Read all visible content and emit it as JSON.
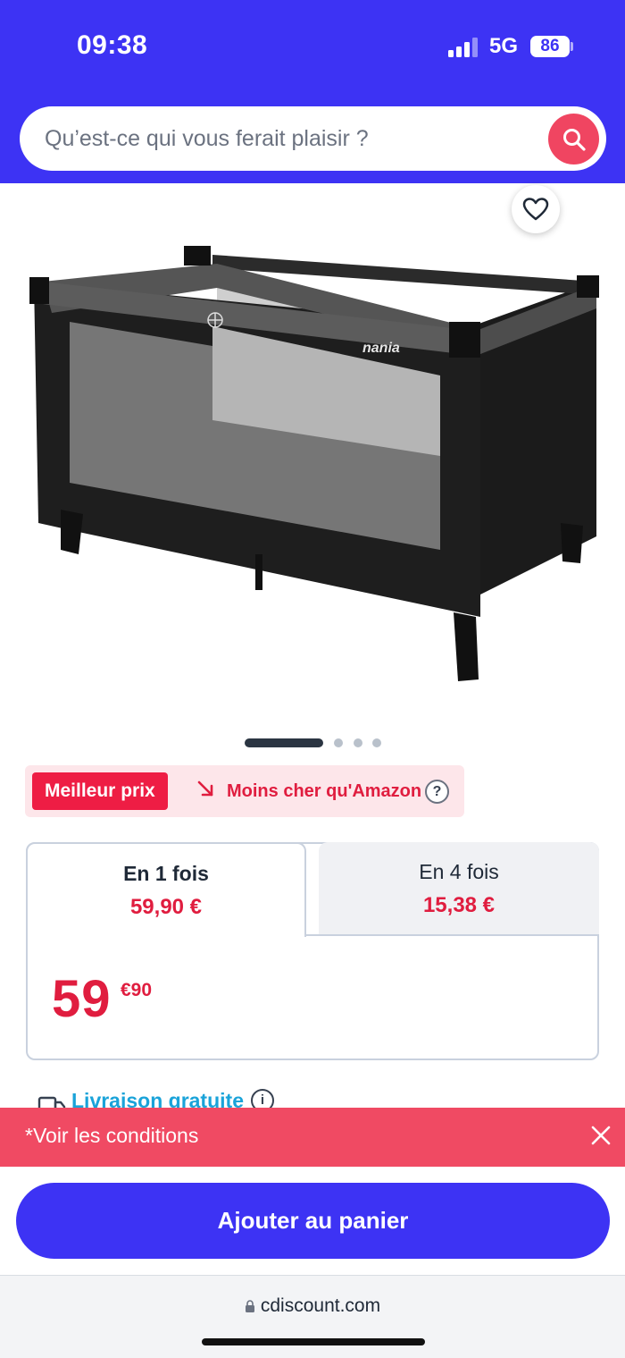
{
  "status_bar": {
    "time": "09:38",
    "network": "5G",
    "battery": "86"
  },
  "search": {
    "placeholder": "Qu’est-ce qui vous ferait plaisir ?"
  },
  "product": {
    "brand_label": "nania",
    "gallery_pages": 4,
    "gallery_active_index": 0
  },
  "badges": {
    "best_price": "Meilleur prix",
    "cheaper_than": "Moins cher qu'Amazon",
    "help": "?"
  },
  "payment": {
    "tabs": [
      {
        "label": "En 1 fois",
        "price": "59,90 €",
        "selected": true
      },
      {
        "label": "En 4 fois",
        "price": "15,38 €",
        "selected": false
      }
    ],
    "price_integer": "59",
    "price_cents": "€90"
  },
  "delivery": {
    "label": "Livraison gratuite",
    "info": "i"
  },
  "conditions": {
    "text": "*Voir les conditions"
  },
  "cart": {
    "button_label": "Ajouter au panier"
  },
  "browser": {
    "url": "cdiscount.com"
  },
  "colors": {
    "brand_blue": "#3d33f4",
    "accent_red": "#e01d3f",
    "banner_pink": "#f04a63"
  }
}
